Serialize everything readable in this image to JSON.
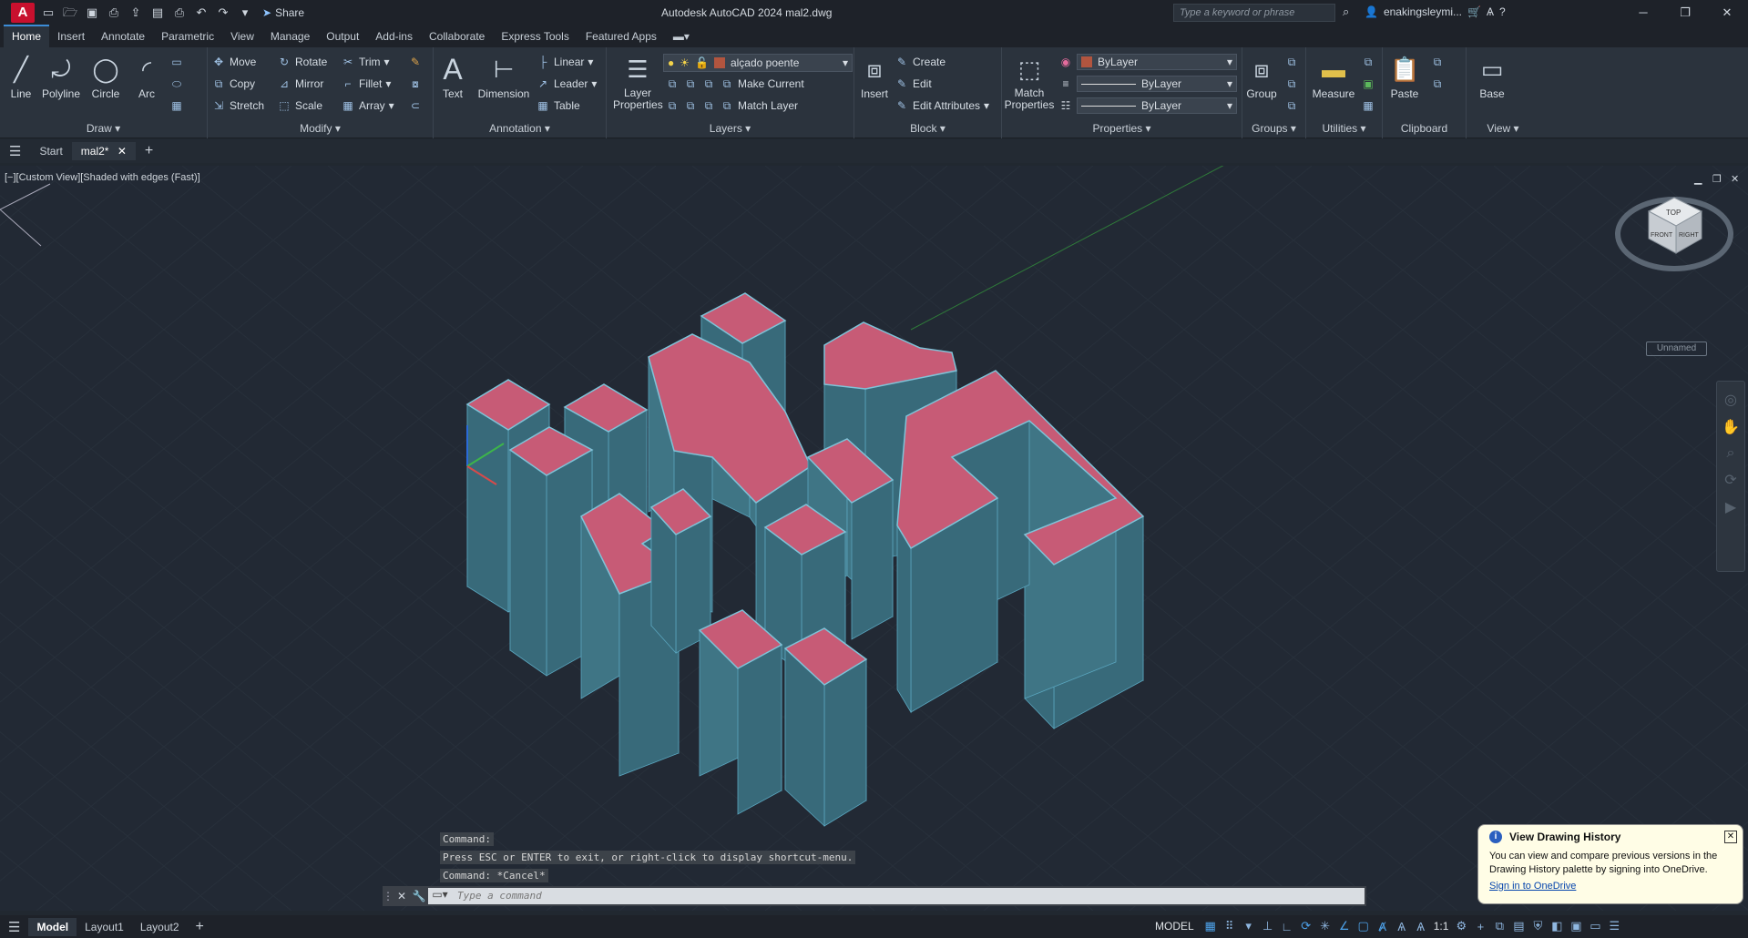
{
  "titlebar": {
    "app_letter": "A",
    "share_label": "Share",
    "title": "Autodesk AutoCAD 2024    mal2.dwg",
    "search_placeholder": "Type a keyword or phrase",
    "user_name": "enakingsleymi..."
  },
  "ribbon_tabs": [
    "Home",
    "Insert",
    "Annotate",
    "Parametric",
    "View",
    "Manage",
    "Output",
    "Add-ins",
    "Collaborate",
    "Express Tools",
    "Featured Apps"
  ],
  "ribbon": {
    "draw": {
      "title": "Draw",
      "line": "Line",
      "polyline": "Polyline",
      "circle": "Circle",
      "arc": "Arc"
    },
    "modify": {
      "title": "Modify",
      "move": "Move",
      "rotate": "Rotate",
      "trim": "Trim",
      "copy": "Copy",
      "mirror": "Mirror",
      "fillet": "Fillet",
      "stretch": "Stretch",
      "scale": "Scale",
      "array": "Array"
    },
    "annotation": {
      "title": "Annotation",
      "text": "Text",
      "dimension": "Dimension",
      "linear": "Linear",
      "leader": "Leader",
      "table": "Table"
    },
    "layers": {
      "title": "Layers",
      "layer_properties": "Layer Properties",
      "current_layer": "alçado poente",
      "make_current": "Make Current",
      "match_layer": "Match Layer"
    },
    "block": {
      "title": "Block",
      "insert": "Insert",
      "create": "Create",
      "edit": "Edit",
      "edit_attributes": "Edit Attributes"
    },
    "properties": {
      "title": "Properties",
      "match_properties": "Match Properties",
      "color": "ByLayer",
      "linetype": "ByLayer",
      "lineweight": "ByLayer"
    },
    "groups": {
      "title": "Groups",
      "group": "Group"
    },
    "utilities": {
      "title": "Utilities",
      "measure": "Measure"
    },
    "clipboard": {
      "title": "Clipboard",
      "paste": "Paste"
    },
    "view": {
      "title": "View",
      "base": "Base"
    }
  },
  "file_tabs": {
    "start": "Start",
    "active": "mal2*"
  },
  "viewport": {
    "label": "[−][Custom View][Shaded with edges (Fast)]",
    "viewcube_name": "Unnamed",
    "viewcube_faces": {
      "top": "TOP",
      "front": "FRONT",
      "right": "RIGHT"
    }
  },
  "command_line": {
    "history": [
      "Command:",
      "Press ESC or ENTER to exit, or right-click to display shortcut-menu.",
      "Command: *Cancel*"
    ],
    "placeholder": "Type a command"
  },
  "notification": {
    "title": "View Drawing History",
    "body": "You can view and compare previous versions in the Drawing History palette by signing into OneDrive.",
    "link": "Sign in to OneDrive"
  },
  "statusbar": {
    "tabs": [
      "Model",
      "Layout1",
      "Layout2"
    ],
    "space": "MODEL",
    "scale": "1:1"
  },
  "colors": {
    "roof": "#c75b76",
    "wall": "#3d6f80",
    "background": "#222934",
    "accent": "#3c8cd6"
  }
}
